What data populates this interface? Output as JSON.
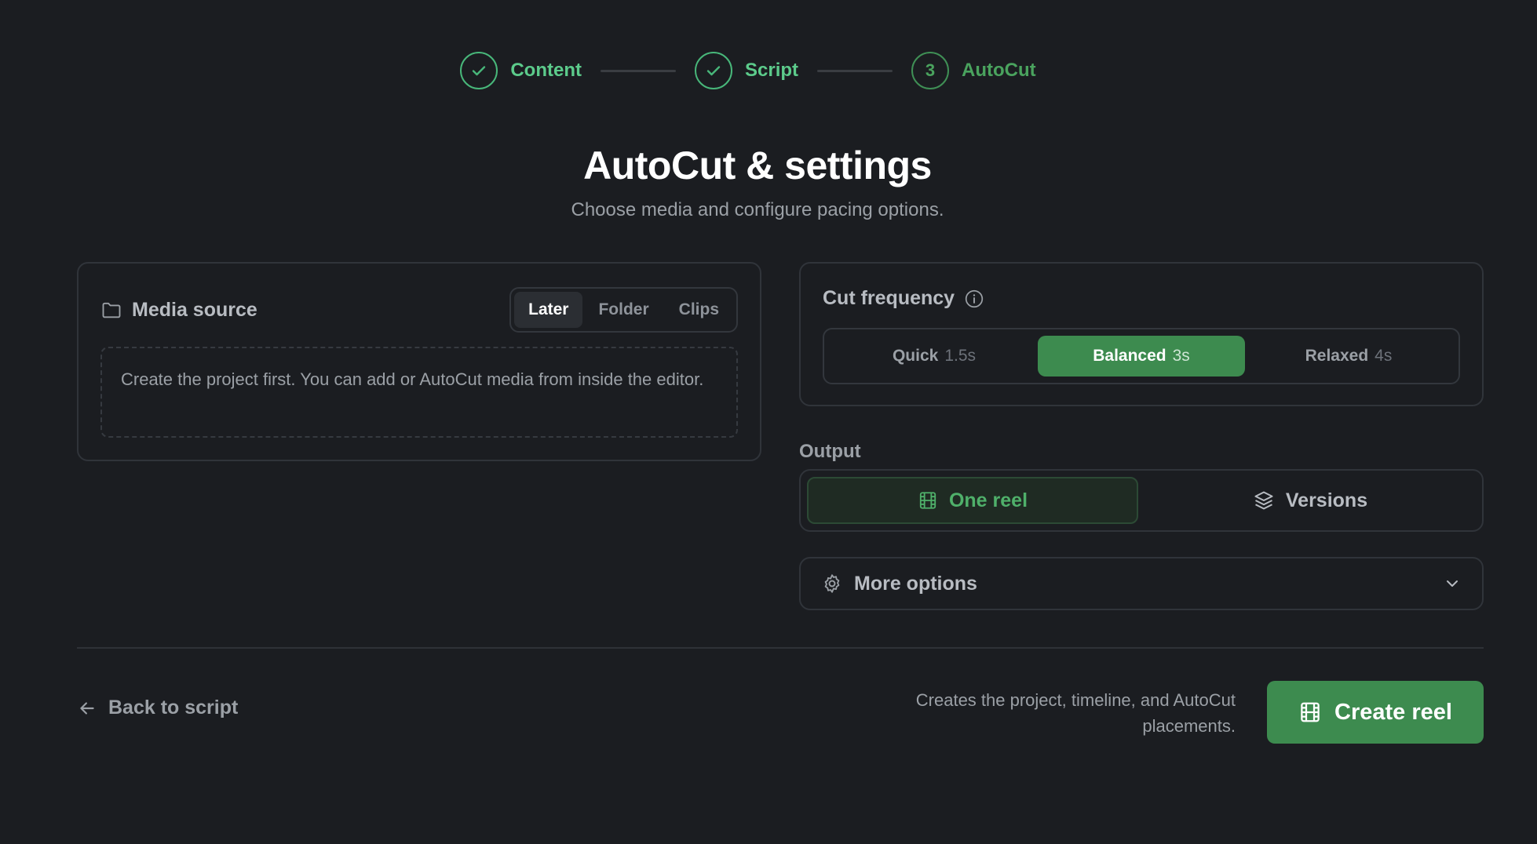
{
  "stepper": {
    "steps": [
      {
        "label": "Content",
        "state": "complete"
      },
      {
        "label": "Script",
        "state": "complete"
      },
      {
        "label": "AutoCut",
        "state": "current",
        "number": "3"
      }
    ]
  },
  "header": {
    "title": "AutoCut & settings",
    "subtitle": "Choose media and configure pacing options."
  },
  "media_source": {
    "title": "Media source",
    "icon": "folder-icon",
    "options": [
      "Later",
      "Folder",
      "Clips"
    ],
    "selected": "Later",
    "note": "Create the project first. You can add or AutoCut media from inside the editor."
  },
  "cut_frequency": {
    "title": "Cut frequency",
    "info_icon": "info-icon",
    "options": [
      {
        "label": "Quick",
        "value": "1.5s"
      },
      {
        "label": "Balanced",
        "value": "3s"
      },
      {
        "label": "Relaxed",
        "value": "4s"
      }
    ],
    "selected": "Balanced"
  },
  "output": {
    "label": "Output",
    "options": [
      {
        "label": "One reel",
        "icon": "film-icon"
      },
      {
        "label": "Versions",
        "icon": "layers-icon"
      }
    ],
    "selected": "One reel"
  },
  "more_options": {
    "label": "More options",
    "icon": "gear-icon",
    "chevron": "chevron-down-icon"
  },
  "footer": {
    "back_label": "Back to script",
    "note": "Creates the project, timeline, and AutoCut placements.",
    "create_label": "Create reel"
  },
  "colors": {
    "background": "#1b1d21",
    "accent": "#3d8b4f",
    "step_complete": "#48b77a",
    "card_border": "#30343a"
  }
}
